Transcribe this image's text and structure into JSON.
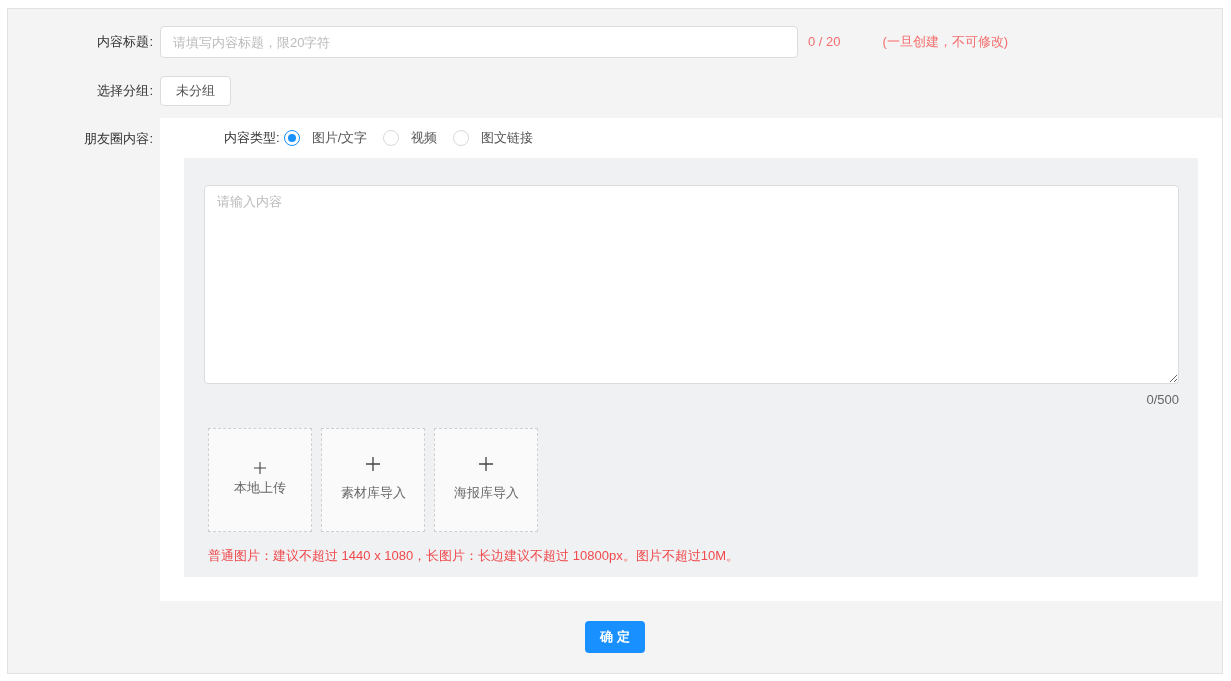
{
  "title_row": {
    "label": "内容标题:",
    "placeholder": "请填写内容标题，限20字符",
    "counter": "0 / 20",
    "note": "(一旦创建，不可修改)"
  },
  "group_row": {
    "label": "选择分组:",
    "button": "未分组"
  },
  "content_row": {
    "label": "朋友圈内容:",
    "type_label": "内容类型:",
    "types": [
      {
        "label": "图片/文字",
        "selected": true
      },
      {
        "label": "视频",
        "selected": false
      },
      {
        "label": "图文链接",
        "selected": false
      }
    ],
    "textarea": {
      "placeholder": "请输入内容",
      "counter": "0/500"
    },
    "uploads": [
      "本地上传",
      "素材库导入",
      "海报库导入"
    ],
    "hint": "普通图片：建议不超过 1440 x 1080，长图片：长边建议不超过 10800px。图片不超过10M。"
  },
  "submit": "确 定"
}
